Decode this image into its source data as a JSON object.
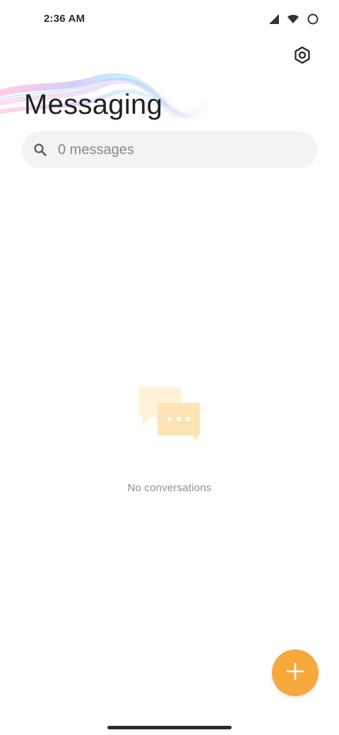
{
  "status_bar": {
    "time": "2:36 AM",
    "icons": [
      "cellular-signal-icon",
      "wifi-icon",
      "battery-circle-icon"
    ]
  },
  "header": {
    "title": "Messaging",
    "settings_icon": "settings-hexagon-icon"
  },
  "search": {
    "placeholder": "0 messages",
    "icon": "search-icon"
  },
  "empty_state": {
    "icon": "chat-bubbles-icon",
    "text": "No conversations"
  },
  "fab": {
    "icon": "plus-icon",
    "color": "#f7a93b"
  },
  "colors": {
    "accent": "#f7a93b",
    "empty_icon_light": "#fdf1d8",
    "empty_icon_main": "#fde4b4"
  }
}
